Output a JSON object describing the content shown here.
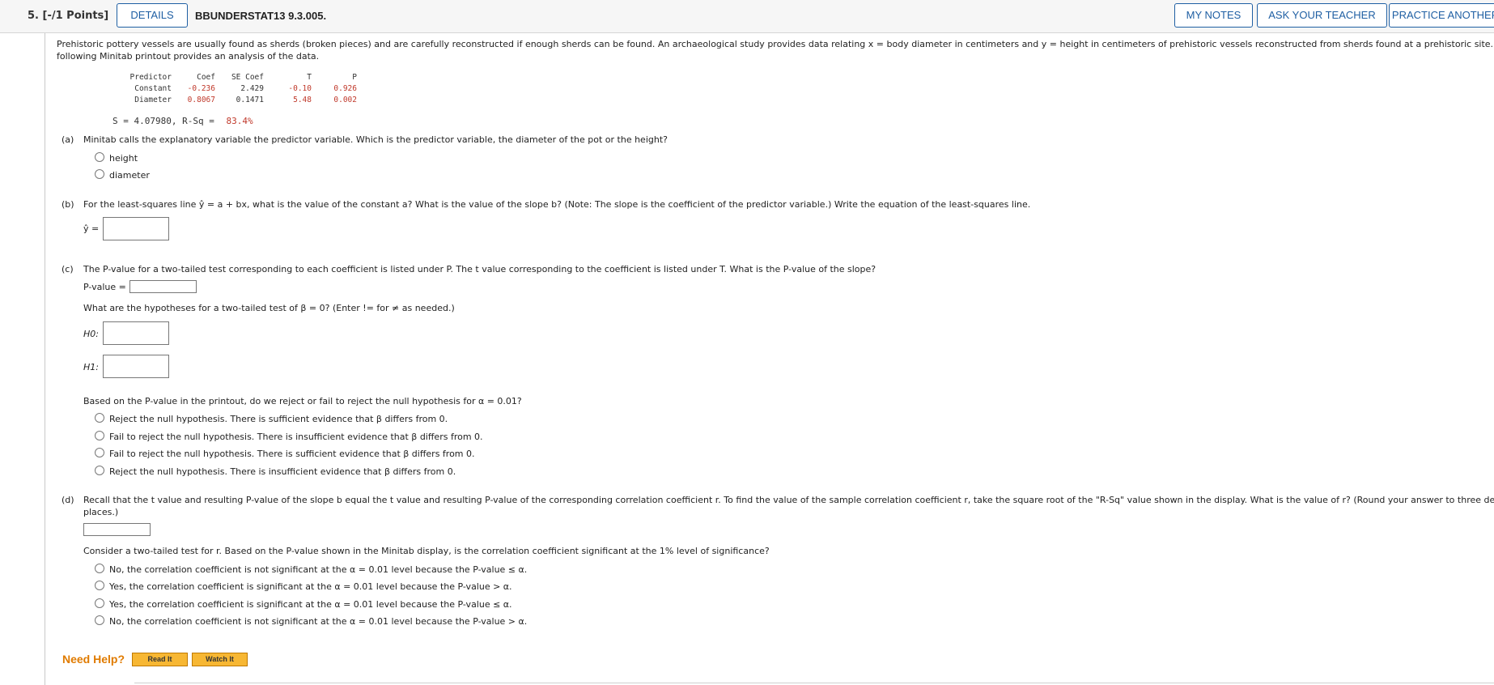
{
  "header": {
    "question_number": "5.  [-/1 Points]",
    "details_label": "DETAILS",
    "question_id": "BBUNDERSTAT13 9.3.005.",
    "my_notes_label": "MY NOTES",
    "ask_teacher_label": "ASK YOUR TEACHER",
    "practice_label": "PRACTICE ANOTHER"
  },
  "intro": {
    "line1": "Prehistoric pottery vessels are usually found as sherds (broken pieces) and are carefully reconstructed if enough sherds can be found. An archaeological study provides data relating x = body diameter in centimeters and y = height in centimeters of prehistoric vessels reconstructed from sherds found at a prehistoric site. The",
    "line2": "following Minitab printout provides an analysis of the data."
  },
  "minitab": {
    "headers": [
      "Predictor",
      "Coef",
      "SE Coef",
      "T",
      "P"
    ],
    "rows": [
      [
        "Constant",
        "-0.236",
        "2.429",
        "-0.10",
        "0.926"
      ],
      [
        "Diameter",
        "0.8067",
        "0.1471",
        "5.48",
        "0.002"
      ]
    ],
    "s_line_prefix": "S = 4.07980,  R-Sq  =",
    "rsq": "83.4%"
  },
  "part_a": {
    "label": "(a)",
    "question": "Minitab calls the explanatory variable the predictor variable. Which is the predictor variable, the diameter of the pot or the height?",
    "options": [
      "height",
      "diameter"
    ]
  },
  "part_b": {
    "label": "(b)",
    "question": "For the least-squares line ŷ = a + bx, what is the value of the constant a? What is the value of the slope b? (Note: The slope is the coefficient of the predictor variable.) Write the equation of the least-squares line.",
    "yhat_label": "ŷ ="
  },
  "part_c": {
    "label": "(c)",
    "question": "The P-value for a two-tailed test corresponding to each coefficient is listed under P. The t value corresponding to the coefficient is listed under T. What is the P-value of the slope?",
    "pvalue_label": "P-value =",
    "hyp_question": "What are the hypotheses for a two-tailed test of β = 0? (Enter != for ≠ as needed.)",
    "h0_label": "H0:",
    "h1_label": "H1:",
    "decision_question": "Based on the P-value in the printout, do we reject or fail to reject the null hypothesis for α = 0.01?",
    "options": [
      "Reject the null hypothesis. There is sufficient evidence that β differs from 0.",
      "Fail to reject the null hypothesis. There is insufficient evidence that β differs from 0.",
      "Fail to reject the null hypothesis. There is sufficient evidence that β differs from 0.",
      "Reject the null hypothesis. There is insufficient evidence that β differs from 0."
    ]
  },
  "part_d": {
    "label": "(d)",
    "question_line1": "Recall that the t value and resulting P-value of the slope b equal the t value and resulting P-value of the corresponding correlation coefficient r. To find the value of the sample correlation coefficient r, take the square root of the \"R-Sq\" value shown in the display. What is the value of r? (Round your answer to three decimal",
    "question_line2": "places.)",
    "consider": "Consider a two-tailed test for r. Based on the P-value shown in the Minitab display, is the correlation coefficient significant at the 1% level of significance?",
    "options": [
      "No, the correlation coefficient is not significant at the α = 0.01 level because the P-value ≤ α.",
      "Yes, the correlation coefficient is significant at the α = 0.01 level because the P-value > α.",
      "Yes, the correlation coefficient is significant at the α = 0.01 level because the P-value ≤ α.",
      "No, the correlation coefficient is not significant at the α = 0.01 level because the P-value > α."
    ]
  },
  "help": {
    "label": "Need Help?",
    "read_it": "Read It",
    "watch_it": "Watch It"
  }
}
